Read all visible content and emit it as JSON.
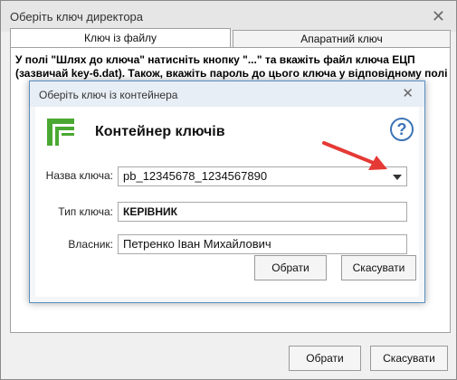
{
  "outer_dialog": {
    "title": "Оберіть ключ директора",
    "tabs": [
      {
        "label": "Ключ із файлу",
        "active": true
      },
      {
        "label": "Апаратний ключ",
        "active": false
      }
    ],
    "instruction_line1": "У полі \"Шлях до ключа\" натисніть кнопку \"...\" та вкажіть файл ключа ЕЦП",
    "instruction_line2": "(зазвичай key-6.dat). Також, вкажіть пароль до цього ключа у відповідному полі",
    "ok_label": "Обрати",
    "cancel_label": "Скасувати"
  },
  "inner_dialog": {
    "title": "Оберіть ключ із контейнера",
    "heading": "Контейнер ключів",
    "help_glyph": "?",
    "fields": {
      "key_name_label": "Назва ключа:",
      "key_name_value": "pb_12345678_1234567890",
      "key_type_label": "Тип ключа:",
      "key_type_value": "КЕРІВНИК",
      "owner_label": "Власник:",
      "owner_value": "Петренко Іван Михайлович"
    },
    "ok_label": "Обрати",
    "cancel_label": "Скасувати"
  },
  "colors": {
    "logo_green": "#4aa832",
    "annotation_arrow": "#e53935",
    "help_blue": "#3d74b8"
  }
}
